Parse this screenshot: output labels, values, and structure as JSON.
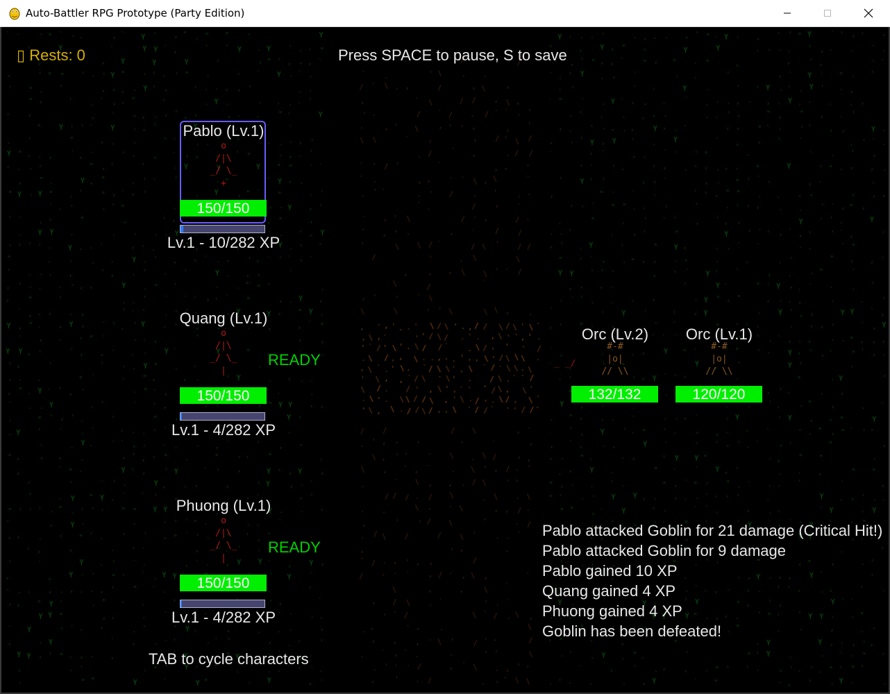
{
  "window": {
    "title": "Auto-Battler RPG Prototype (Party Edition)"
  },
  "hud": {
    "rests_icon": "zzz-icon",
    "rests": "▯ Rests: 0",
    "pause_hint": "Press SPACE to pause, S to save",
    "tab_hint": "TAB to cycle characters"
  },
  "party": [
    {
      "name": "Pablo (Lv.1)",
      "hp": "150/150",
      "hp_fraction": 1.0,
      "xp": "Lv.1 - 10/282 XP",
      "xp_fraction": 0.035,
      "ready": "",
      "selected": true
    },
    {
      "name": "Quang (Lv.1)",
      "hp": "150/150",
      "hp_fraction": 1.0,
      "xp": "Lv.1 - 4/282 XP",
      "xp_fraction": 0.014,
      "ready": "READY",
      "selected": false
    },
    {
      "name": "Phuong (Lv.1)",
      "hp": "150/150",
      "hp_fraction": 1.0,
      "xp": "Lv.1 - 4/282 XP",
      "xp_fraction": 0.014,
      "ready": "READY",
      "selected": false
    }
  ],
  "enemies": [
    {
      "name": "Orc (Lv.2)",
      "hp": "132/132",
      "hp_fraction": 1.0
    },
    {
      "name": "Orc (Lv.1)",
      "hp": "120/120",
      "hp_fraction": 1.0
    }
  ],
  "log": [
    "Pablo attacked Goblin for 21 damage (Critical Hit!)",
    "Pablo attacked Goblin for 9 damage",
    "Pablo gained 10 XP",
    "Quang gained 4 XP",
    "Phuong gained 4 XP",
    "Goblin has been defeated!"
  ],
  "colors": {
    "hp": "#00ee00",
    "ready": "#00d200",
    "rests": "#d5b000",
    "selection": "#6a5cff",
    "background_glyphs": "#0f5a12",
    "path_glyphs": "#5a2e12"
  }
}
